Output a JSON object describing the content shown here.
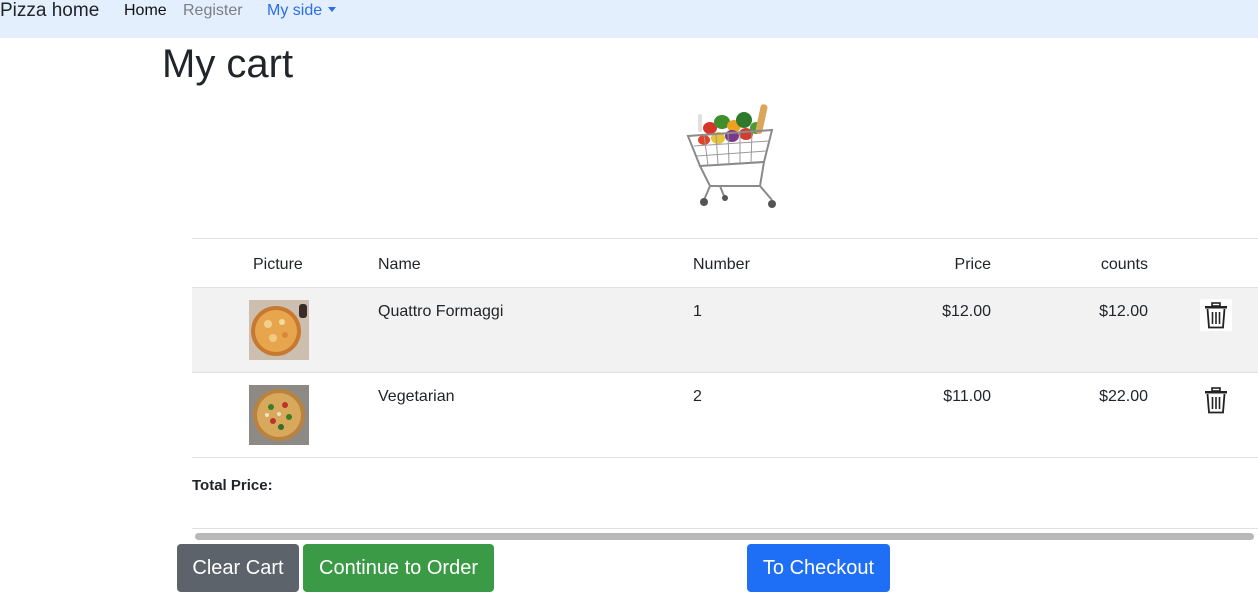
{
  "navbar": {
    "brand": "Pizza home",
    "links": {
      "home": "Home",
      "register": "Register",
      "my_side": "My side"
    }
  },
  "page": {
    "title": "My cart"
  },
  "cart_table": {
    "headers": {
      "picture": "Picture",
      "name": "Name",
      "number": "Number",
      "price": "Price",
      "counts": "counts"
    },
    "rows": [
      {
        "name": "Quattro Formaggi",
        "number": "1",
        "price": "$12.00",
        "counts": "$12.00",
        "picture": "pizza-quattro-formaggi-image"
      },
      {
        "name": "Vegetarian",
        "number": "2",
        "price": "$11.00",
        "counts": "$22.00",
        "picture": "pizza-vegetarian-image"
      }
    ],
    "delete_icon": "trash-icon"
  },
  "total": {
    "label": "Total Price:"
  },
  "actions": {
    "clear_cart": "Clear Cart",
    "continue_to_order": "Continue to Order",
    "to_checkout": "To Checkout"
  },
  "colors": {
    "navbar_bg": "#e3effd",
    "link_active": "#2a6ee8",
    "btn_secondary": "#5c636a",
    "btn_success": "#3b9a45",
    "btn_primary": "#1f6ef6",
    "row_striped": "#f2f2f2"
  }
}
